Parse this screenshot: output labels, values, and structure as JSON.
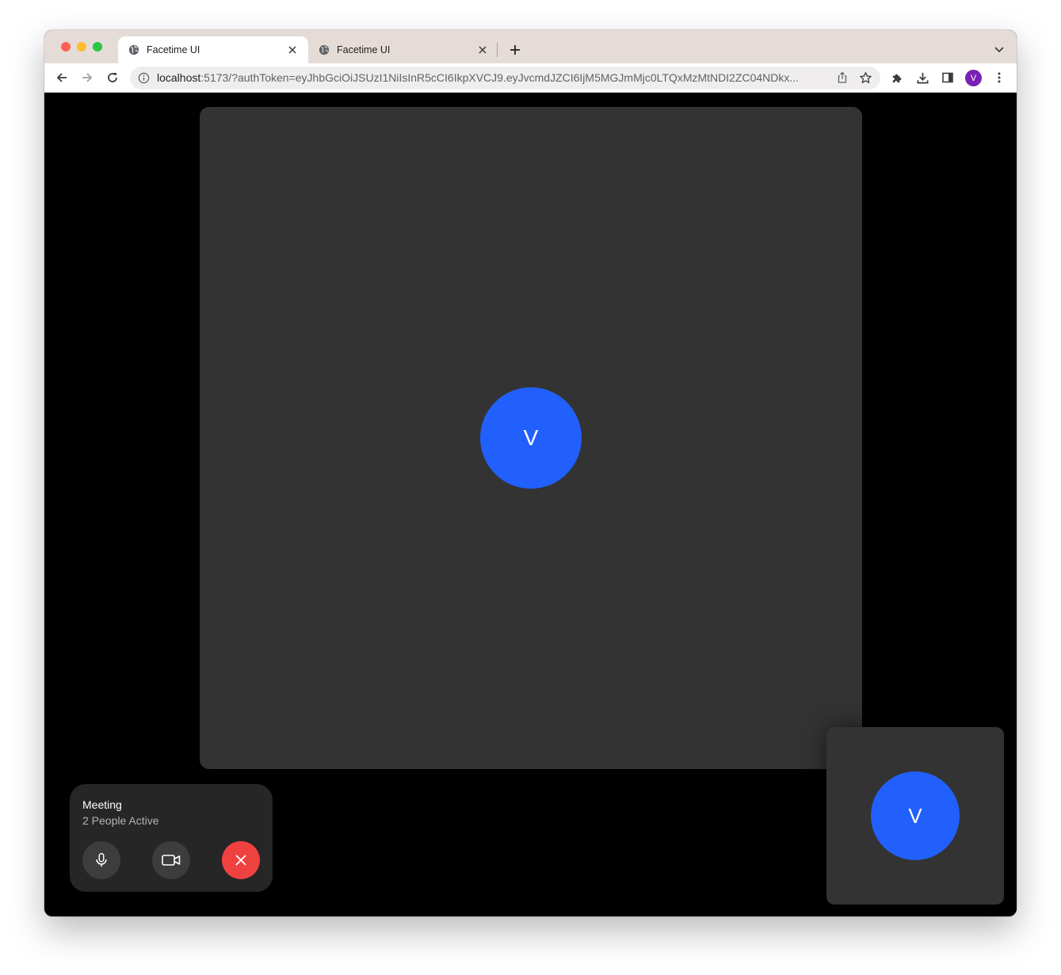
{
  "browser": {
    "tabs": [
      {
        "title": "Facetime UI",
        "active": true
      },
      {
        "title": "Facetime UI",
        "active": false
      }
    ],
    "url_host": "localhost",
    "url_rest": ":5173/?authToken=eyJhbGciOiJSUzI1NiIsInR5cCI6IkpXVCJ9.eyJvcmdJZCI6IjM5MGJmMjc0LTQxMzMtNDI2ZC04NDkx...",
    "profile_initial": "V"
  },
  "call": {
    "main_participant_initial": "V",
    "self_participant_initial": "V",
    "meeting_title": "Meeting",
    "active_count_text": "2 People Active"
  },
  "colors": {
    "avatar": "#2160fc",
    "end_call": "#f04141",
    "tile": "#333333",
    "panel": "#262626",
    "profile": "#7a21b5"
  },
  "icons": {
    "mic": "microphone-icon",
    "camera": "video-camera-icon",
    "end": "close-icon"
  }
}
